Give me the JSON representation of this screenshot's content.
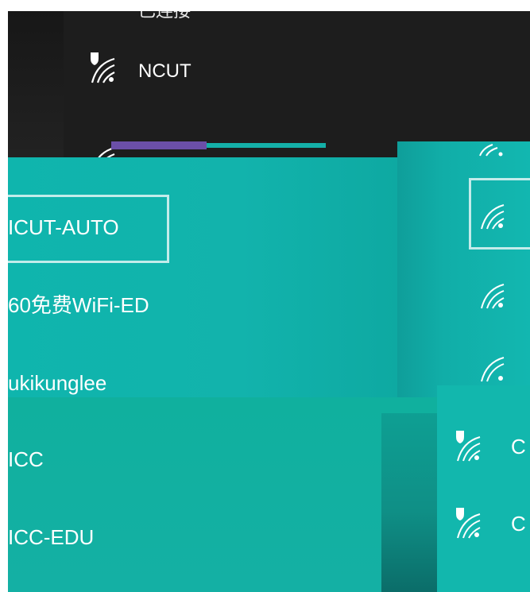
{
  "dark_panel": {
    "top_partial_label": "已连接",
    "network_ncut": "NCUT"
  },
  "left_list": {
    "items": [
      {
        "label": "ICUT-AUTO",
        "selected": true
      },
      {
        "label": "60免费WiFi-ED"
      },
      {
        "label": "ukikunglee"
      },
      {
        "label": "ICC"
      },
      {
        "label": "ICC-EDU"
      }
    ]
  },
  "right_list": {
    "items": [
      {
        "label": "C"
      },
      {
        "label": "C"
      }
    ]
  },
  "colors": {
    "dark": "#1d1d1d",
    "teal": "#12b3ac",
    "text": "#ffffff"
  },
  "icons": [
    "wifi-icon",
    "wifi-secured-icon"
  ]
}
